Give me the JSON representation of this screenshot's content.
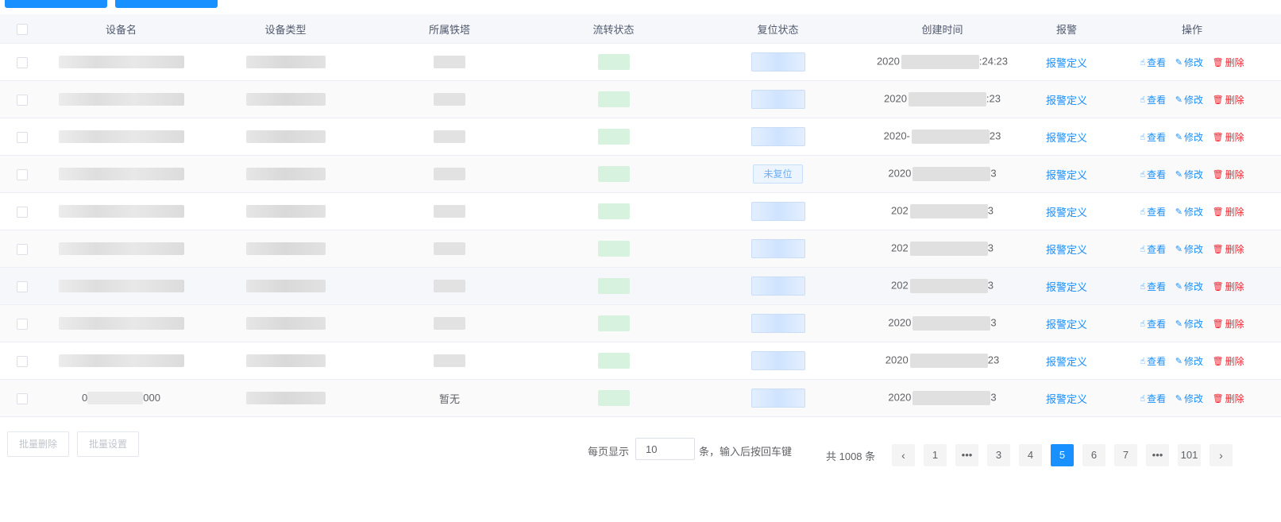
{
  "table": {
    "headers": [
      "设备名",
      "设备类型",
      "所属铁塔",
      "流转状态",
      "复位状态",
      "创建时间",
      "报警",
      "操作"
    ],
    "rows": [
      {
        "name": "",
        "type": "",
        "tower": "",
        "reset": "",
        "time_prefix": "2020",
        "time_suffix": ":24:23"
      },
      {
        "name": "",
        "type": "",
        "tower": "",
        "reset": "",
        "time_prefix": "2020",
        "time_suffix": ":23"
      },
      {
        "name": "",
        "type": "",
        "tower": "",
        "reset": "",
        "time_prefix": "2020-",
        "time_suffix": "23"
      },
      {
        "name": "",
        "type": "",
        "tower": "",
        "reset": "未复位",
        "time_prefix": "2020",
        "time_suffix": "3"
      },
      {
        "name": "",
        "type": "",
        "tower": "",
        "reset": "",
        "time_prefix": "202",
        "time_suffix": "3"
      },
      {
        "name": "",
        "type": "",
        "tower": "",
        "reset": "",
        "time_prefix": "202",
        "time_suffix": "3"
      },
      {
        "name": "",
        "type": "",
        "tower": "",
        "reset": "",
        "time_prefix": "202",
        "time_suffix": "3"
      },
      {
        "name": "",
        "type": "",
        "tower": "",
        "reset": "",
        "time_prefix": "2020",
        "time_suffix": "3"
      },
      {
        "name": "",
        "type": "",
        "tower": "",
        "reset": "",
        "time_prefix": "2020",
        "time_suffix": "23"
      },
      {
        "name": "0",
        "name_suffix": "000",
        "type": "",
        "tower": "暂无",
        "reset": "",
        "time_prefix": "2020",
        "time_suffix": "3"
      }
    ],
    "alarm_label": "报警定义",
    "view_label": "查看",
    "edit_label": "修改",
    "delete_label": "删除"
  },
  "footer": {
    "batch_delete": "批量删除",
    "batch_set": "批量设置",
    "page_size_label": "每页显示",
    "page_size_value": "10",
    "page_size_hint": "条，输入后按回车键",
    "total": "共 1008 条",
    "pages": [
      "1",
      "•••",
      "3",
      "4",
      "5",
      "6",
      "7",
      "•••",
      "101"
    ],
    "current_page": "5",
    "prev": "‹",
    "next": "›"
  },
  "colors": {
    "primary": "#1890ff",
    "danger": "#f5222d"
  }
}
